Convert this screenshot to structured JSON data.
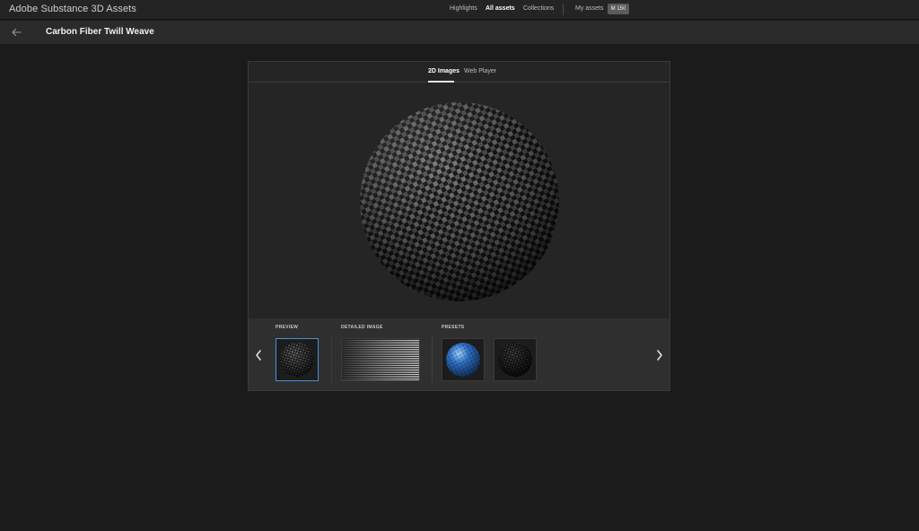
{
  "app": {
    "title": "Adobe Substance 3D Assets"
  },
  "nav": {
    "highlights": "Highlights",
    "all_assets": "All assets",
    "collections": "Collections",
    "my_assets": "My assets",
    "credits": "M 150"
  },
  "header": {
    "title": "Carbon Fiber Twill Weave"
  },
  "viewer": {
    "tabs": [
      {
        "label": "2D Images",
        "active": true
      },
      {
        "label": "Web Player",
        "active": false
      }
    ],
    "strip": {
      "preview_label": "PREVIEW",
      "detailed_label": "DETAILED IMAGE",
      "presets_label": "PRESETS"
    }
  },
  "colors": {
    "background": "#1b1b1b",
    "topbar": "#242424",
    "accent_selected": "#4a90d9",
    "preset_blue": "#2f6fc4"
  },
  "icons": {
    "back": "arrow-left-icon",
    "prev": "chevron-left-icon",
    "next": "chevron-right-icon"
  }
}
